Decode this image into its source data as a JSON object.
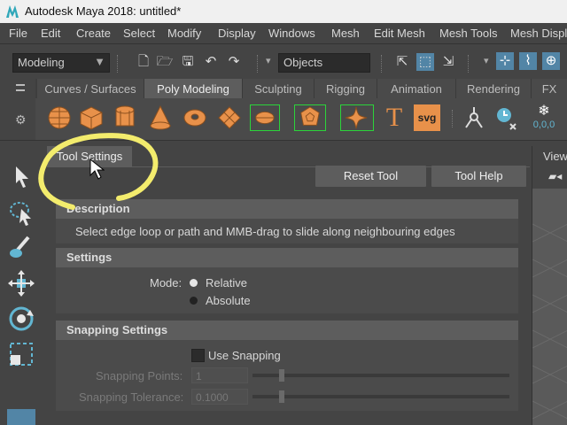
{
  "window": {
    "title": "Autodesk Maya 2018: untitled*"
  },
  "menu": [
    "File",
    "Edit",
    "Create",
    "Select",
    "Modify",
    "Display",
    "Windows",
    "Mesh",
    "Edit Mesh",
    "Mesh Tools",
    "Mesh Display"
  ],
  "statusline": {
    "menuset": "Modeling",
    "selection_mask": "Objects"
  },
  "shelf_tabs": [
    "Curves / Surfaces",
    "Poly Modeling",
    "Sculpting",
    "Rigging",
    "Animation",
    "Rendering",
    "FX"
  ],
  "shelf_active": "Poly Modeling",
  "shelf_icons": [
    "poly-sphere-icon",
    "poly-cube-icon",
    "poly-cylinder-icon",
    "poly-cone-icon",
    "poly-torus-icon",
    "poly-plane-icon",
    "poly-disc-icon",
    "poly-platonic-icon",
    "super-shape-icon",
    "type-icon",
    "svg-icon"
  ],
  "shelf_text": {
    "type": "T",
    "svg": "svg",
    "counter": "0,0,0"
  },
  "tool_settings": {
    "tab_label": "Tool Settings",
    "reset_label": "Reset Tool",
    "help_label": "Tool Help",
    "description": {
      "header": "Description",
      "text": "Select edge loop or path and MMB-drag to slide along neighbouring edges"
    },
    "settings": {
      "header": "Settings",
      "mode_label": "Mode:",
      "options": [
        "Relative",
        "Absolute"
      ],
      "selected": "Relative"
    },
    "snapping": {
      "header": "Snapping Settings",
      "use_snapping_label": "Use Snapping",
      "use_snapping": false,
      "points_label": "Snapping Points:",
      "points_value": "1",
      "tolerance_label": "Snapping Tolerance:",
      "tolerance_value": "0.1000"
    }
  },
  "viewport": {
    "menu_label": "View"
  },
  "colors": {
    "accent_orange": "#e8914a",
    "highlight_blue": "#5285a6",
    "annotation_yellow": "#f3ec6d"
  }
}
